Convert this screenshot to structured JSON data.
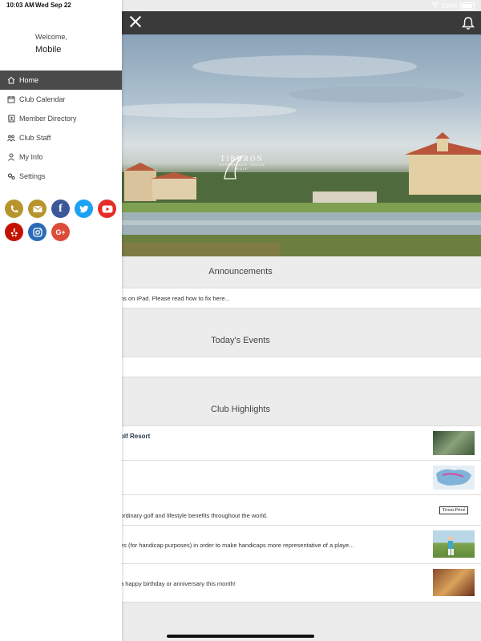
{
  "status_bar": {
    "time": "10:03 AM",
    "date": "Wed Sep 22",
    "battery": "100%"
  },
  "drawer": {
    "welcome": "Welcome,",
    "username": "Mobile",
    "menu": [
      {
        "label": "Home",
        "icon": "home-icon",
        "active": true
      },
      {
        "label": "Club Calendar",
        "icon": "calendar-icon"
      },
      {
        "label": "Member Directory",
        "icon": "address-book-icon"
      },
      {
        "label": "Club Staff",
        "icon": "staff-icon"
      },
      {
        "label": "My Info",
        "icon": "user-icon"
      },
      {
        "label": "Settings",
        "icon": "gears-icon"
      }
    ],
    "socials": [
      {
        "name": "phone",
        "color": "#b8942c"
      },
      {
        "name": "email",
        "color": "#b8942c"
      },
      {
        "name": "facebook",
        "color": "#3b5998"
      },
      {
        "name": "twitter",
        "color": "#1da1f2"
      },
      {
        "name": "youtube",
        "color": "#e52d27"
      },
      {
        "name": "yelp",
        "color": "#c41200"
      },
      {
        "name": "instagram",
        "color": "#2a6ab7"
      },
      {
        "name": "google-plus",
        "color": "#dd4b39"
      }
    ]
  },
  "hero": {
    "brand": "TIBURON",
    "tagline": "EXPERIENCE TROON GOLF"
  },
  "announcements": {
    "title": "Announcements",
    "items": [
      "ns on iPad. Please read how to fix here..."
    ]
  },
  "events": {
    "title": "Today's Events"
  },
  "highlights": {
    "title": "Club Highlights",
    "items": [
      {
        "text": "olf Resort"
      },
      {
        "text": ""
      },
      {
        "text": "ordinary golf and lifestyle benefits throughout the world.",
        "thumb_text": "Troon Privé"
      },
      {
        "text": "es (for handicap purposes) in order to make handicaps more representative of a playe..."
      },
      {
        "text": "a happy birthday or anniversary this month!"
      }
    ]
  }
}
